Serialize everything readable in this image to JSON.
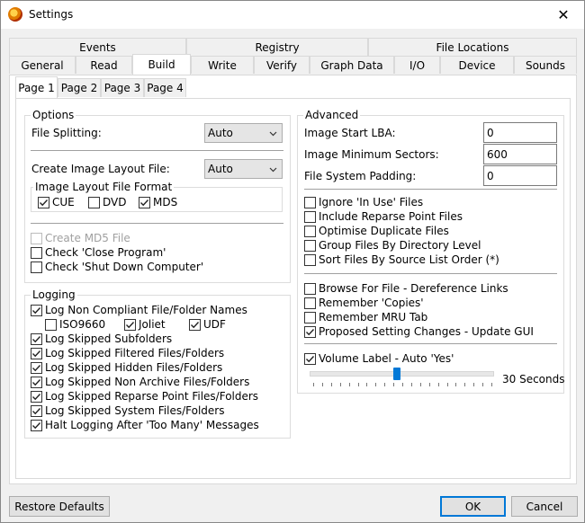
{
  "window": {
    "title": "Settings"
  },
  "tabs_row1": [
    "Events",
    "Registry",
    "File Locations"
  ],
  "tabs_row2": [
    "General",
    "Read",
    "Build",
    "Write",
    "Verify",
    "Graph Data",
    "I/O",
    "Device",
    "Sounds"
  ],
  "subtabs": [
    "Page 1",
    "Page 2",
    "Page 3",
    "Page 4"
  ],
  "options": {
    "legend": "Options",
    "file_splitting_label": "File Splitting:",
    "file_splitting_value": "Auto",
    "create_layout_label": "Create Image Layout File:",
    "create_layout_value": "Auto",
    "layout_format_legend": "Image Layout File Format",
    "formats": [
      {
        "label": "CUE",
        "checked": true
      },
      {
        "label": "DVD",
        "checked": false
      },
      {
        "label": "MDS",
        "checked": true
      }
    ],
    "checks": [
      {
        "label": "Create MD5 File",
        "checked": false,
        "disabled": true
      },
      {
        "label": "Check 'Close Program'",
        "checked": false,
        "disabled": false
      },
      {
        "label": "Check 'Shut Down Computer'",
        "checked": false,
        "disabled": false
      }
    ]
  },
  "logging": {
    "legend": "Logging",
    "noncompliant_label": "Log Non Compliant File/Folder Names",
    "noncompliant_checked": true,
    "sub": [
      {
        "label": "ISO9660",
        "checked": false
      },
      {
        "label": "Joliet",
        "checked": true
      },
      {
        "label": "UDF",
        "checked": true
      }
    ],
    "items": [
      {
        "label": "Log Skipped Subfolders",
        "checked": true
      },
      {
        "label": "Log Skipped Filtered Files/Folders",
        "checked": true
      },
      {
        "label": "Log Skipped Hidden Files/Folders",
        "checked": true
      },
      {
        "label": "Log Skipped Non Archive Files/Folders",
        "checked": true
      },
      {
        "label": "Log Skipped Reparse Point Files/Folders",
        "checked": true
      },
      {
        "label": "Log Skipped System Files/Folders",
        "checked": true
      },
      {
        "label": "Halt Logging After 'Too Many' Messages",
        "checked": true
      }
    ]
  },
  "advanced": {
    "legend": "Advanced",
    "start_lba_label": "Image Start LBA:",
    "start_lba_value": "0",
    "min_sectors_label": "Image Minimum Sectors:",
    "min_sectors_value": "600",
    "padding_label": "File System Padding:",
    "padding_value": "0",
    "group1": [
      {
        "label": "Ignore 'In Use' Files",
        "checked": false
      },
      {
        "label": "Include Reparse Point Files",
        "checked": false
      },
      {
        "label": "Optimise Duplicate Files",
        "checked": false
      },
      {
        "label": "Group Files By Directory Level",
        "checked": false
      },
      {
        "label": "Sort Files By Source List Order (*)",
        "checked": false
      }
    ],
    "group2": [
      {
        "label": "Browse For File - Dereference Links",
        "checked": false
      },
      {
        "label": "Remember 'Copies'",
        "checked": false
      },
      {
        "label": "Remember MRU Tab",
        "checked": false
      },
      {
        "label": "Proposed Setting Changes - Update GUI",
        "checked": true
      }
    ],
    "volume_label": "Volume Label - Auto 'Yes'",
    "volume_checked": true,
    "slider_value_fraction": 0.48,
    "slider_text": "30 Seconds"
  },
  "buttons": {
    "restore": "Restore Defaults",
    "ok": "OK",
    "cancel": "Cancel"
  }
}
